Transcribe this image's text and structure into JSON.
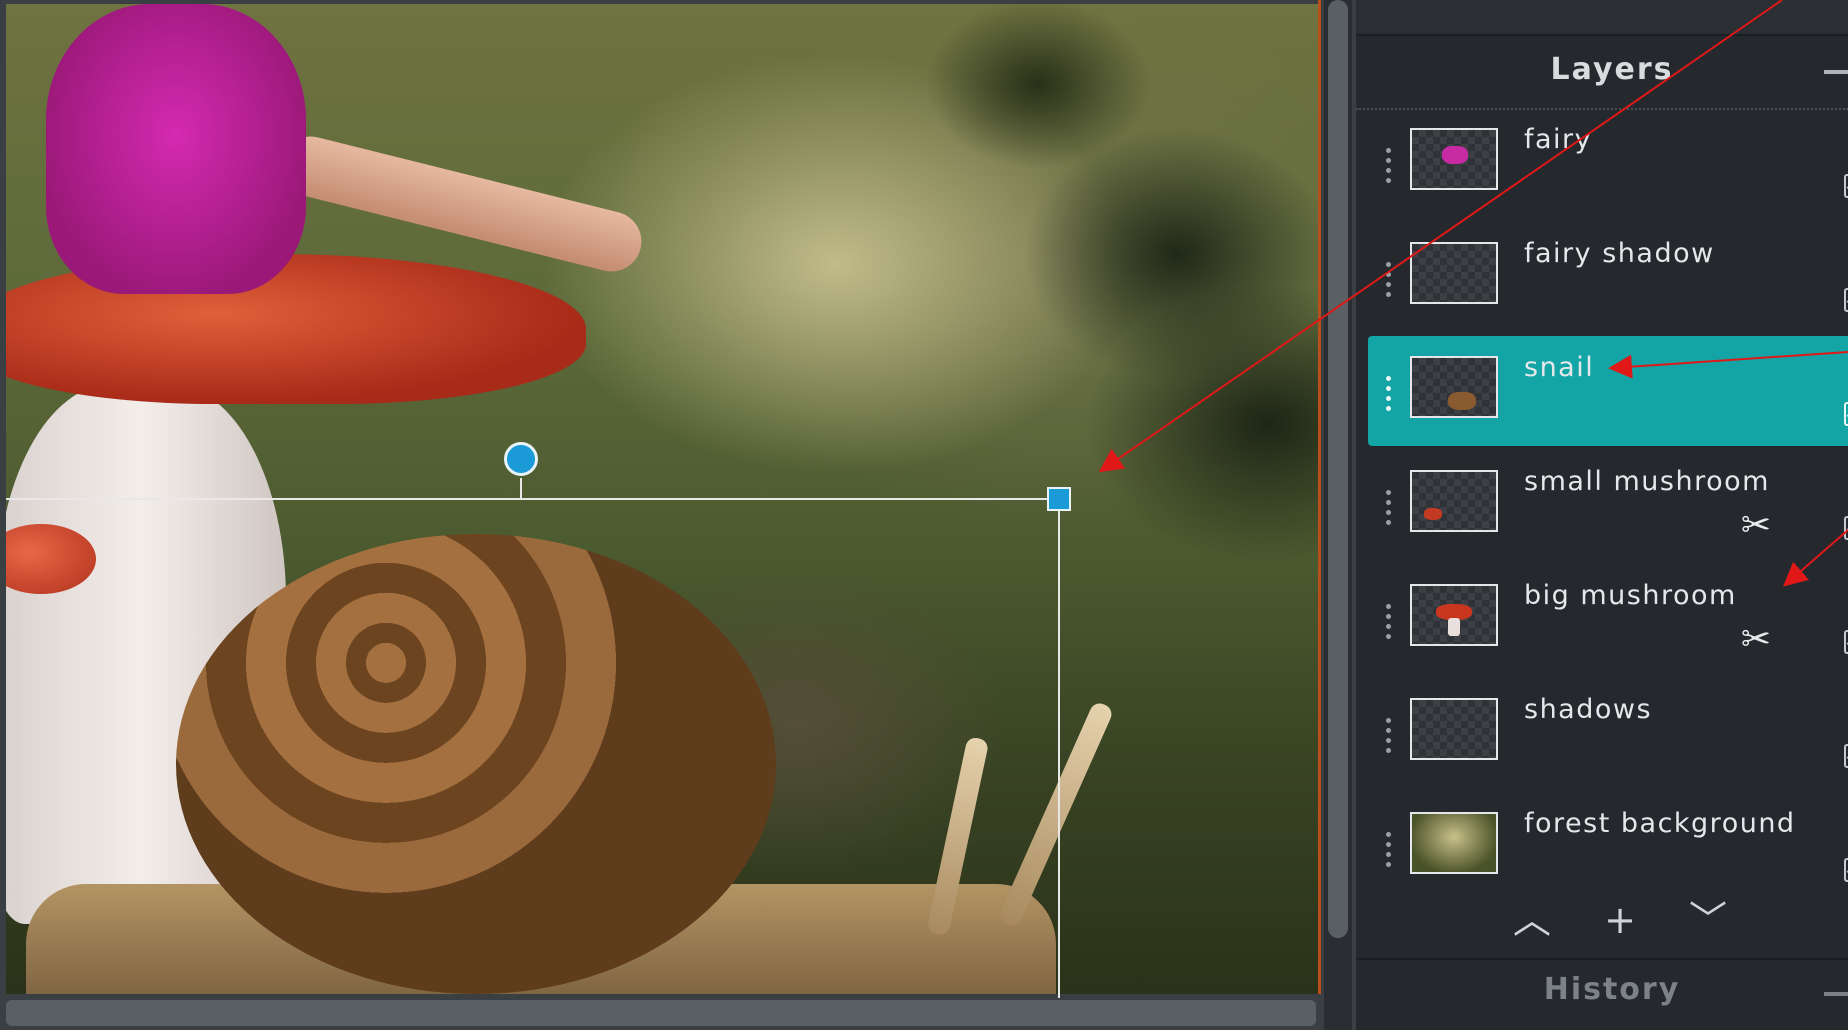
{
  "layers_panel": {
    "title": "Layers",
    "layers": [
      {
        "name": "fairy",
        "visible": true,
        "selected": false,
        "has_mask": false
      },
      {
        "name": "fairy shadow",
        "visible": true,
        "selected": false,
        "has_mask": false
      },
      {
        "name": "snail",
        "visible": true,
        "selected": true,
        "has_mask": false
      },
      {
        "name": "small mushroom",
        "visible": true,
        "selected": false,
        "has_mask": true
      },
      {
        "name": "big mushroom",
        "visible": true,
        "selected": false,
        "has_mask": true
      },
      {
        "name": "shadows",
        "visible": true,
        "selected": false,
        "has_mask": false
      },
      {
        "name": "forest background",
        "visible": true,
        "selected": false,
        "has_mask": false
      }
    ],
    "controls": {
      "move_up_icon": "chevron-up-icon",
      "add_icon": "plus-icon",
      "move_down_icon": "chevron-down-icon"
    }
  },
  "history_panel": {
    "title": "History"
  },
  "colors": {
    "selection_accent": "#13a5a5",
    "handle_blue": "#1a9bd8",
    "annotation_red": "#e01818",
    "panel_bg": "#25292d"
  }
}
